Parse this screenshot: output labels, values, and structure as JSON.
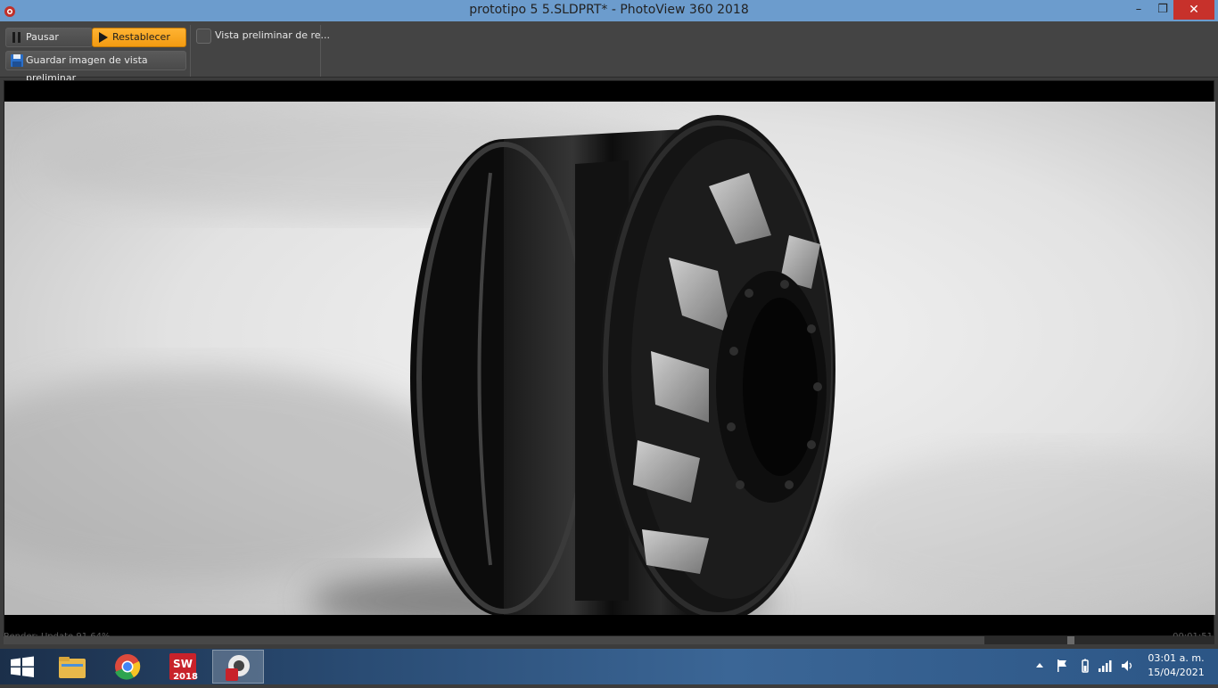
{
  "window": {
    "title": "prototipo 5 5.SLDPRT* - PhotoView 360 2018",
    "minimize_glyph": "–",
    "restore_glyph": "❐",
    "close_glyph": "✕"
  },
  "toolbar": {
    "pause_label": "Pausar",
    "reset_label": "Restablecer",
    "save_label": "Guardar imagen de vista preliminar",
    "preview_checkbox_label": "Vista preliminar de re...",
    "preview_checked": false
  },
  "viewport": {
    "render_status": "Render: Update 91.64%",
    "elapsed_time": "00:01:51",
    "progress_fraction": 0.81
  },
  "taskbar": {
    "apps": [
      {
        "name": "start",
        "icon": "windows-logo-icon"
      },
      {
        "name": "file-explorer",
        "icon": "folder-icon"
      },
      {
        "name": "chrome",
        "icon": "chrome-icon"
      },
      {
        "name": "solidworks-2018",
        "icon": "solidworks-icon",
        "badge": "2018"
      },
      {
        "name": "photoview-360",
        "icon": "photoview-icon",
        "active": true
      }
    ],
    "sw_badge": "2018",
    "clock_time": "03:01 a. m.",
    "clock_date": "15/04/2021"
  },
  "colors": {
    "accent_orange": "#f6a320",
    "titlebar": "#6c9ccd",
    "close_red": "#c7312b",
    "toolbar": "#444444"
  }
}
